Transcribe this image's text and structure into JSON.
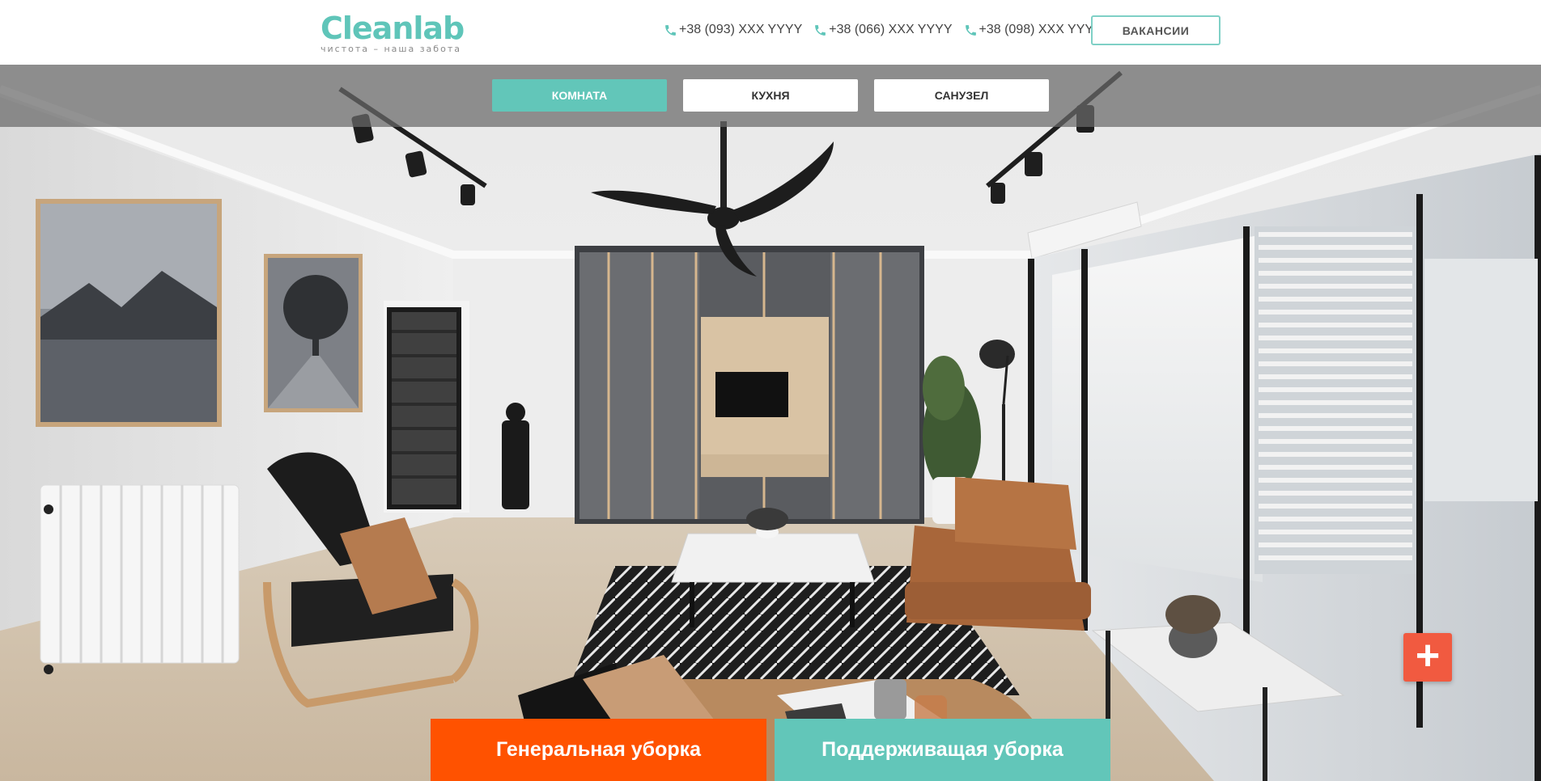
{
  "brand": {
    "name": "Cleanlab",
    "tagline": "чистота – наша забота",
    "color": "#5fc5b9"
  },
  "header": {
    "phones": [
      "+38 (093) XXX YYYY",
      "+38 (066) XXX YYYY",
      "+38 (098) XXX YYYY"
    ],
    "phone_icon": "phone-icon",
    "vacancies_label": "ВАКАНСИИ"
  },
  "tabs": [
    {
      "label": "КОМНАТА",
      "active": true
    },
    {
      "label": "КУХНЯ",
      "active": false
    },
    {
      "label": "САНУЗЕЛ",
      "active": false
    }
  ],
  "hero": {
    "scene": "living-room-photo",
    "add_button_icon": "plus-icon",
    "add_button_symbol": "+"
  },
  "cta": {
    "general_label": "Генеральная уборка",
    "support_label": "Поддерживащая уборка"
  },
  "colors": {
    "accent": "#62c6b9",
    "orange": "#ff5200",
    "plus": "#f15a40"
  }
}
